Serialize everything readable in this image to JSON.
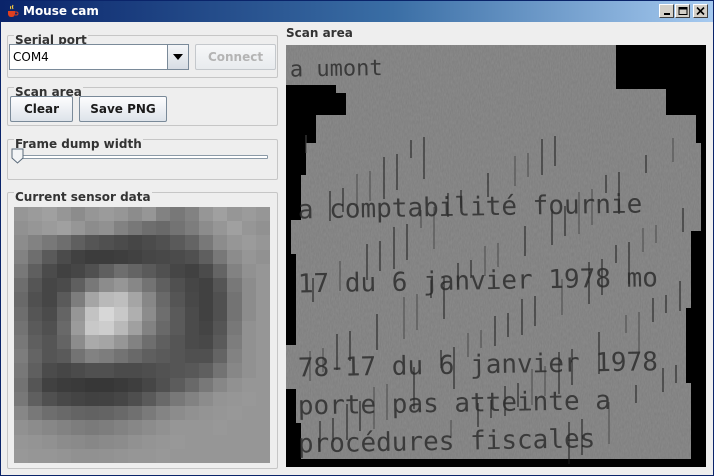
{
  "window": {
    "title": "Mouse cam"
  },
  "serial": {
    "section_label": "Serial port",
    "port_value": "COM4",
    "connect_label": "Connect",
    "connect_enabled": false
  },
  "scan_controls": {
    "section_label": "Scan area",
    "clear_label": "Clear",
    "save_label": "Save PNG"
  },
  "frame_dump": {
    "section_label": "Frame dump width",
    "slider_value_fraction": 0.0
  },
  "sensor": {
    "section_label": "Current sensor data",
    "grid_size": 18,
    "pixels": [
      [
        150,
        155,
        160,
        150,
        140,
        150,
        155,
        150,
        140,
        150,
        130,
        120,
        130,
        150,
        160,
        150,
        155,
        150
      ],
      [
        145,
        150,
        155,
        160,
        150,
        140,
        145,
        130,
        120,
        110,
        105,
        115,
        125,
        140,
        150,
        160,
        150,
        145
      ],
      [
        140,
        130,
        120,
        110,
        95,
        85,
        80,
        75,
        70,
        75,
        80,
        90,
        100,
        120,
        140,
        150,
        155,
        150
      ],
      [
        130,
        110,
        90,
        75,
        65,
        60,
        60,
        62,
        65,
        70,
        72,
        75,
        80,
        95,
        120,
        140,
        150,
        145
      ],
      [
        120,
        95,
        75,
        65,
        70,
        80,
        95,
        110,
        100,
        90,
        80,
        70,
        65,
        75,
        100,
        130,
        145,
        150
      ],
      [
        110,
        85,
        70,
        75,
        95,
        120,
        140,
        150,
        135,
        115,
        95,
        80,
        70,
        65,
        85,
        120,
        140,
        150
      ],
      [
        105,
        80,
        70,
        90,
        125,
        165,
        185,
        190,
        165,
        135,
        105,
        85,
        72,
        65,
        80,
        115,
        140,
        150
      ],
      [
        110,
        85,
        75,
        100,
        150,
        195,
        215,
        200,
        175,
        140,
        110,
        90,
        75,
        65,
        80,
        115,
        140,
        150
      ],
      [
        115,
        90,
        80,
        105,
        155,
        200,
        205,
        185,
        160,
        130,
        105,
        90,
        75,
        68,
        85,
        120,
        145,
        150
      ],
      [
        120,
        95,
        85,
        100,
        140,
        170,
        165,
        150,
        130,
        110,
        95,
        85,
        75,
        72,
        90,
        125,
        145,
        150
      ],
      [
        125,
        100,
        85,
        90,
        115,
        130,
        125,
        115,
        105,
        95,
        90,
        85,
        80,
        80,
        100,
        130,
        145,
        150
      ],
      [
        120,
        95,
        75,
        70,
        75,
        80,
        80,
        75,
        75,
        78,
        82,
        85,
        88,
        95,
        115,
        135,
        145,
        150
      ],
      [
        115,
        85,
        65,
        60,
        58,
        55,
        55,
        58,
        62,
        70,
        80,
        92,
        105,
        120,
        135,
        145,
        150,
        150
      ],
      [
        120,
        95,
        80,
        72,
        68,
        65,
        66,
        70,
        78,
        90,
        105,
        120,
        130,
        140,
        148,
        150,
        152,
        150
      ],
      [
        135,
        120,
        110,
        105,
        100,
        98,
        100,
        105,
        112,
        122,
        132,
        140,
        145,
        148,
        150,
        152,
        150,
        150
      ],
      [
        145,
        140,
        135,
        130,
        125,
        122,
        125,
        130,
        135,
        140,
        145,
        150,
        150,
        150,
        152,
        150,
        150,
        150
      ],
      [
        150,
        148,
        145,
        140,
        138,
        135,
        138,
        140,
        145,
        148,
        150,
        152,
        150,
        150,
        150,
        150,
        150,
        150
      ],
      [
        152,
        150,
        150,
        148,
        145,
        145,
        146,
        148,
        150,
        150,
        152,
        150,
        150,
        150,
        150,
        150,
        150,
        150
      ]
    ]
  },
  "scan_area": {
    "section_label": "Scan area",
    "text_lines": [
      "a umont",
      "a comptabilité fournie",
      "17 du 6 janvier 1978 mo",
      "78-17 du 6 janvier 1978",
      "porte pas atteinte a",
      "procédures fiscales"
    ]
  },
  "colors": {
    "titlebar_start": "#0a246a",
    "titlebar_end": "#a6caf0",
    "panel_bg": "#eeeeee",
    "scan_bg": "#000000"
  }
}
